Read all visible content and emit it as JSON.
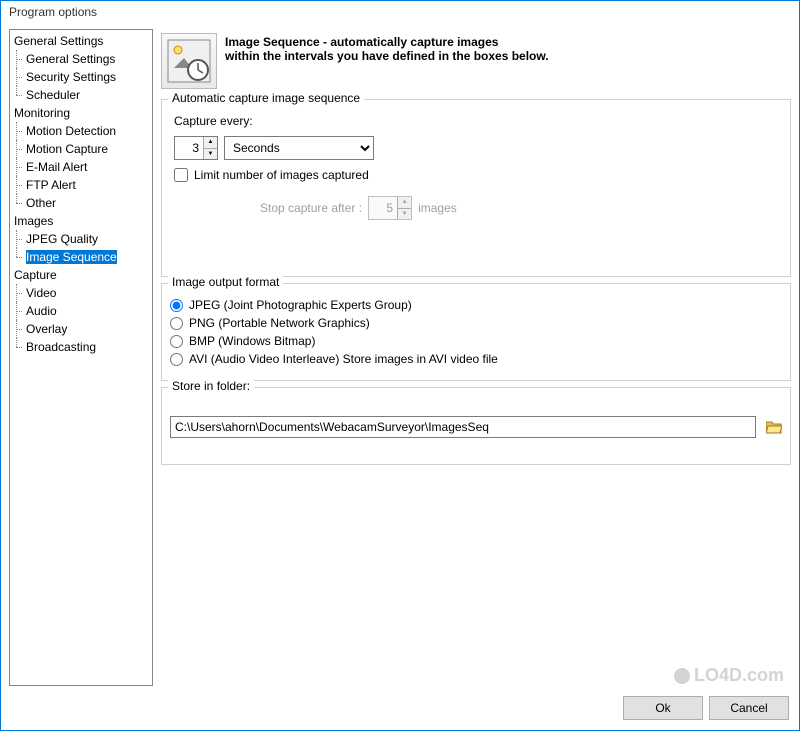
{
  "window": {
    "title": "Program options"
  },
  "sidebar": {
    "groups": [
      {
        "label": "General Settings",
        "children": [
          {
            "label": "General Settings"
          },
          {
            "label": "Security Settings"
          },
          {
            "label": "Scheduler"
          }
        ]
      },
      {
        "label": "Monitoring",
        "children": [
          {
            "label": "Motion Detection"
          },
          {
            "label": "Motion Capture"
          },
          {
            "label": "E-Mail Alert"
          },
          {
            "label": "FTP Alert"
          },
          {
            "label": "Other"
          }
        ]
      },
      {
        "label": "Images",
        "children": [
          {
            "label": "JPEG Quality"
          },
          {
            "label": "Image Sequence",
            "selected": true
          }
        ]
      },
      {
        "label": "Capture",
        "children": [
          {
            "label": "Video"
          },
          {
            "label": "Audio"
          },
          {
            "label": "Overlay"
          },
          {
            "label": "Broadcasting"
          }
        ]
      }
    ]
  },
  "header": {
    "title": "Image Sequence - automatically capture images",
    "subtitle": "within the intervals you have defined in the boxes below."
  },
  "capture": {
    "group_title": "Automatic capture image sequence",
    "every_label": "Capture every:",
    "every_value": "3",
    "every_unit": "Seconds",
    "limit_label": "Limit number of images captured",
    "limit_checked": false,
    "stop_label": "Stop capture after :",
    "stop_value": "5",
    "stop_suffix": "images"
  },
  "format": {
    "group_title": "Image output format",
    "options": [
      {
        "label": "JPEG (Joint Photographic Experts Group)",
        "checked": true
      },
      {
        "label": "PNG (Portable Network Graphics)",
        "checked": false
      },
      {
        "label": "BMP (Windows Bitmap)",
        "checked": false
      },
      {
        "label": "AVI (Audio Video Interleave) Store images in AVI video file",
        "checked": false
      }
    ]
  },
  "store": {
    "group_title": "Store in folder:",
    "path": "C:\\Users\\ahorn\\Documents\\WebacamSurveyor\\ImagesSeq"
  },
  "buttons": {
    "ok": "Ok",
    "cancel": "Cancel"
  },
  "watermark": "LO4D.com"
}
